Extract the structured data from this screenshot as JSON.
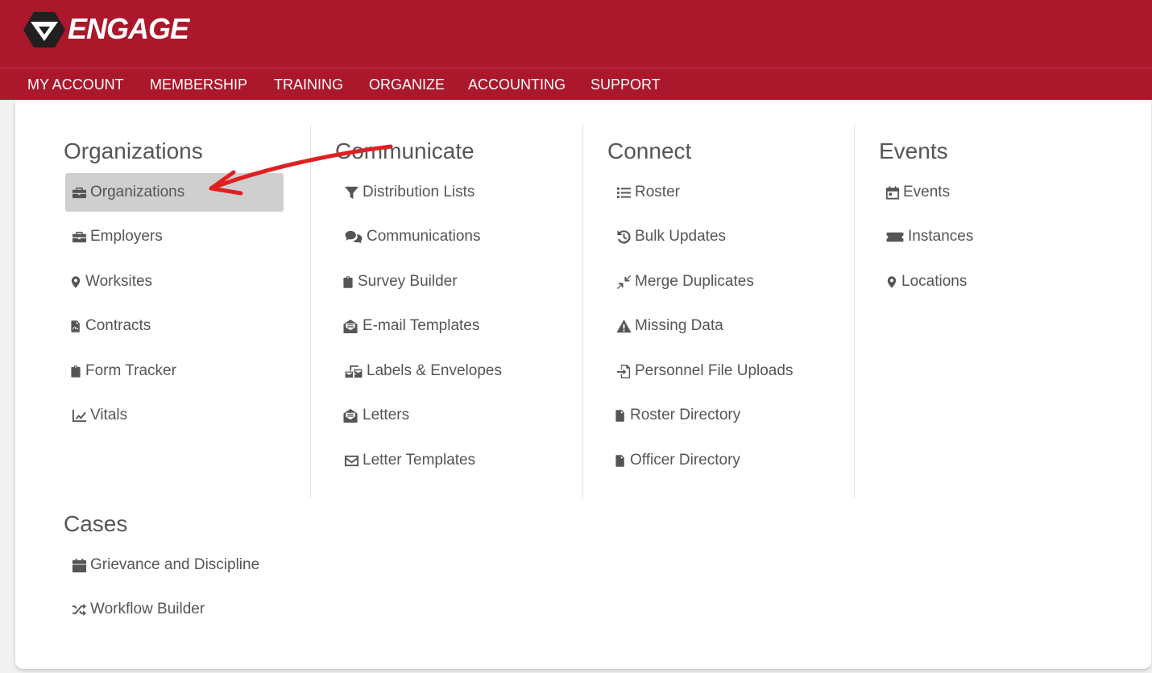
{
  "app": {
    "logo_text": "ENGAGE",
    "logo_tm": "®"
  },
  "colors": {
    "brand": "#ab172b",
    "text": "#555555",
    "active_bg": "#cfcfcf",
    "annotation": "#e02020"
  },
  "nav": [
    "MY ACCOUNT",
    "MEMBERSHIP",
    "TRAINING",
    "ORGANIZE",
    "ACCOUNTING",
    "SUPPORT"
  ],
  "menu": {
    "organizations": {
      "heading": "Organizations",
      "items": [
        {
          "label": "Organizations",
          "icon": "briefcase-icon",
          "active": true
        },
        {
          "label": "Employers",
          "icon": "briefcase-icon"
        },
        {
          "label": "Worksites",
          "icon": "map-marker-icon"
        },
        {
          "label": "Contracts",
          "icon": "file-signature-icon"
        },
        {
          "label": "Form Tracker",
          "icon": "clipboard-check-icon"
        },
        {
          "label": "Vitals",
          "icon": "line-chart-icon"
        }
      ]
    },
    "communicate": {
      "heading": "Communicate",
      "items": [
        {
          "label": "Distribution Lists",
          "icon": "filter-icon"
        },
        {
          "label": "Communications",
          "icon": "comments-icon"
        },
        {
          "label": "Survey Builder",
          "icon": "clipboard-list-icon"
        },
        {
          "label": "E-mail Templates",
          "icon": "envelope-open-text-icon"
        },
        {
          "label": "Labels & Envelopes",
          "icon": "mail-bulk-icon"
        },
        {
          "label": "Letters",
          "icon": "envelope-open-text-icon"
        },
        {
          "label": "Letter Templates",
          "icon": "envelope-outline-icon"
        }
      ]
    },
    "connect": {
      "heading": "Connect",
      "items": [
        {
          "label": "Roster",
          "icon": "list-icon"
        },
        {
          "label": "Bulk Updates",
          "icon": "history-icon"
        },
        {
          "label": "Merge Duplicates",
          "icon": "compress-arrows-icon"
        },
        {
          "label": "Missing Data",
          "icon": "warning-icon"
        },
        {
          "label": "Personnel File Uploads",
          "icon": "file-import-icon"
        },
        {
          "label": "Roster Directory",
          "icon": "file-text-icon"
        },
        {
          "label": "Officer Directory",
          "icon": "file-text-icon"
        }
      ]
    },
    "events": {
      "heading": "Events",
      "items": [
        {
          "label": "Events",
          "icon": "calendar-icon"
        },
        {
          "label": "Instances",
          "icon": "ticket-icon"
        },
        {
          "label": "Locations",
          "icon": "map-marker-icon"
        }
      ]
    },
    "cases": {
      "heading": "Cases",
      "items": [
        {
          "label": "Grievance and Discipline",
          "icon": "calendar-icon"
        },
        {
          "label": "Workflow Builder",
          "icon": "random-icon"
        }
      ]
    }
  }
}
